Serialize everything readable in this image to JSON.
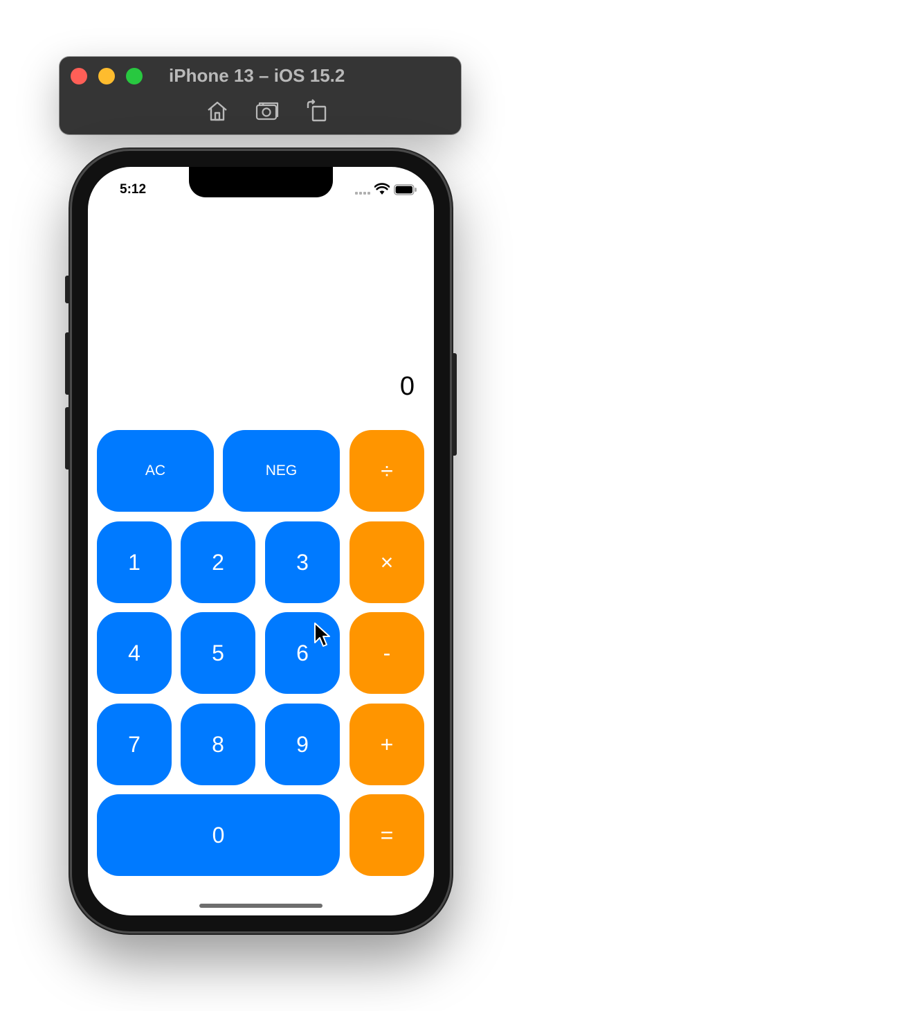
{
  "window": {
    "title": "iPhone 13 – iOS 15.2",
    "controls": [
      "close-button",
      "minimize-button",
      "zoom-button"
    ],
    "toolbar": [
      "home-icon",
      "screenshot-icon",
      "rotate-icon"
    ]
  },
  "status_bar": {
    "time": "5:12"
  },
  "calculator": {
    "display": "0",
    "keys": {
      "ac": "AC",
      "neg": "NEG",
      "divide": "÷",
      "one": "1",
      "two": "2",
      "three": "3",
      "multiply": "×",
      "four": "4",
      "five": "5",
      "six": "6",
      "minus": "-",
      "seven": "7",
      "eight": "8",
      "nine": "9",
      "plus": "+",
      "zero": "0",
      "equals": "="
    }
  },
  "colors": {
    "number_key": "#007aff",
    "operator_key": "#ff9500",
    "titlebar": "#353535"
  }
}
